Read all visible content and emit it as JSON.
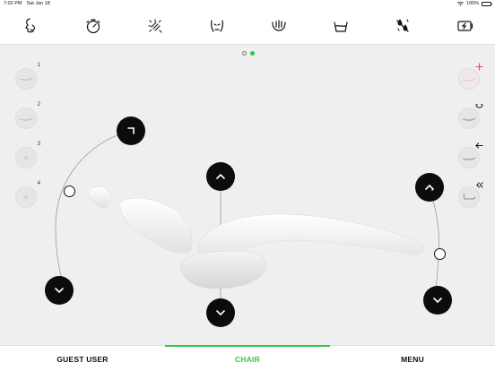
{
  "status_bar": {
    "time": "7:02 PM",
    "date": "Sat Jan 18",
    "battery": "100%"
  },
  "top_toolbar": {
    "icons": [
      "patient-face-icon",
      "timer-icon",
      "light-icon",
      "mouth-icon",
      "spittoon-icon",
      "cup-icon",
      "water-spray-icon",
      "power-settings-icon"
    ]
  },
  "pagination": {
    "pages": 2,
    "current": 2
  },
  "memory_positions": [
    {
      "label": "1",
      "saved": true
    },
    {
      "label": "2",
      "saved": true
    },
    {
      "label": "3",
      "saved": false
    },
    {
      "label": "4",
      "saved": false
    }
  ],
  "right_actions": [
    "add-position-icon",
    "rinse-position-icon",
    "last-position-icon",
    "zero-position-icon"
  ],
  "bottom_nav": {
    "tabs": [
      {
        "label": "GUEST USER",
        "active": false
      },
      {
        "label": "CHAIR",
        "active": true
      },
      {
        "label": "MENU",
        "active": false
      }
    ]
  },
  "colors": {
    "accent": "#2ec84a",
    "control_dark": "#0c0c0c",
    "background": "#efefef",
    "add_accent": "#e8466a"
  }
}
